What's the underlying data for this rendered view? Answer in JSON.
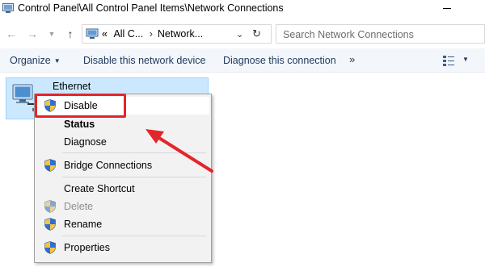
{
  "window": {
    "title": "Control Panel\\All Control Panel Items\\Network Connections"
  },
  "address": {
    "overflow": "«",
    "crumb1": "All C...",
    "crumb2": "Network...",
    "search_placeholder": "Search Network Connections"
  },
  "commands": {
    "organize": "Organize",
    "disable": "Disable this network device",
    "diagnose": "Diagnose this connection",
    "more": "»"
  },
  "connection": {
    "name": "Ethernet"
  },
  "context_menu": {
    "items": [
      {
        "label": "Disable",
        "shield": true,
        "style": "highlighted"
      },
      {
        "label": "Status",
        "shield": false,
        "style": "bold"
      },
      {
        "label": "Diagnose",
        "shield": false,
        "style": "normal"
      },
      {
        "label": "Bridge Connections",
        "shield": true,
        "style": "normal"
      },
      {
        "label": "Create Shortcut",
        "shield": false,
        "style": "normal"
      },
      {
        "label": "Delete",
        "shield": true,
        "style": "disabled"
      },
      {
        "label": "Rename",
        "shield": true,
        "style": "normal"
      },
      {
        "label": "Properties",
        "shield": true,
        "style": "normal"
      }
    ]
  },
  "colors": {
    "annotation_red": "#e3262a",
    "selection_bg": "#cce8ff",
    "command_text": "#1e395b"
  },
  "icons": [
    "control-panel-icon",
    "back-arrow-icon",
    "forward-arrow-icon",
    "dropdown-icon",
    "up-arrow-icon",
    "computer-icon",
    "chevron-down-icon",
    "refresh-icon",
    "change-view-icon",
    "network-adapter-icon",
    "uac-shield-icon"
  ]
}
